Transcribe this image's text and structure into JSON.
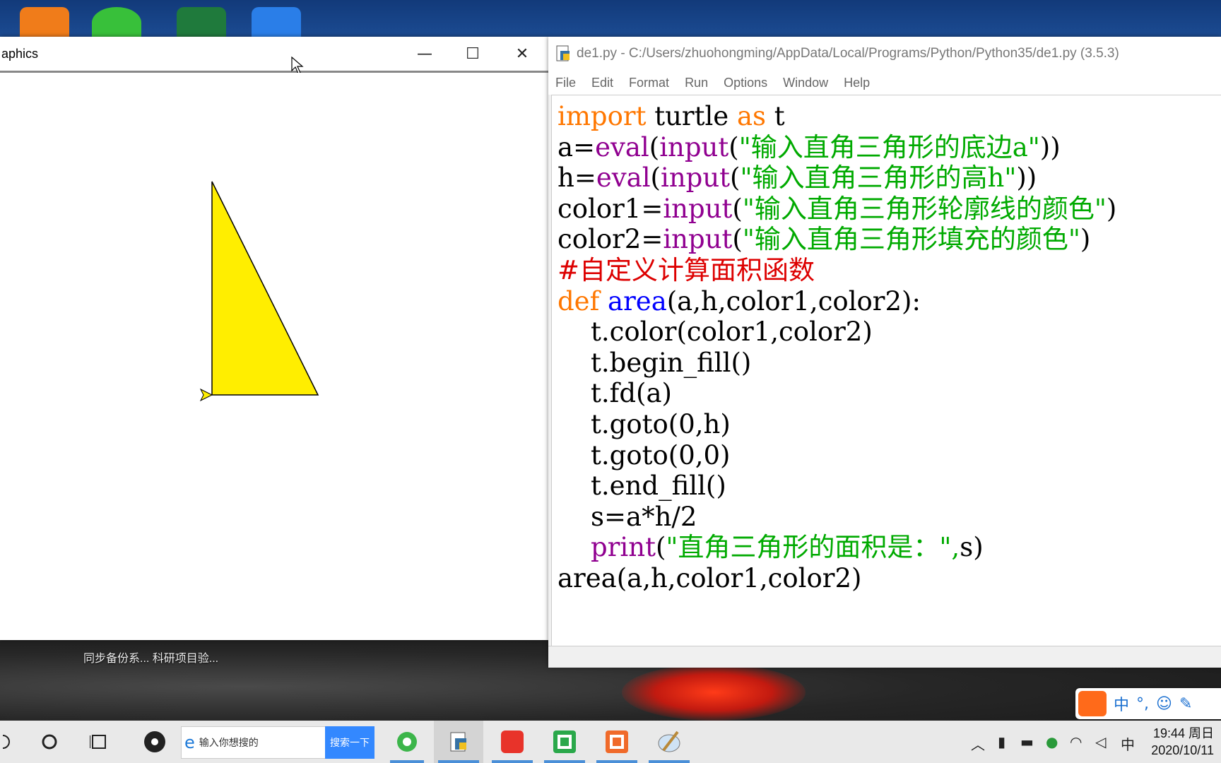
{
  "graphics_window": {
    "title": "aphics",
    "minimize": "—",
    "maximize": "☐",
    "close": "✕",
    "triangle_fill": "#ffee00",
    "triangle_outline": "#000000"
  },
  "idle": {
    "title": "de1.py - C:/Users/zhuohongming/AppData/Local/Programs/Python/Python35/de1.py (3.5.3)",
    "menu": [
      "File",
      "Edit",
      "Format",
      "Run",
      "Options",
      "Window",
      "Help"
    ]
  },
  "desktop": {
    "caption_line1": "同步备份系... 科研项目验..."
  },
  "ime": {
    "lang": "中",
    "punct": "°,",
    "emoji": "☺",
    "tool": "✎"
  },
  "taskbar": {
    "search_placeholder": "输入你想搜的",
    "search_button": "搜索一下",
    "clock_time": "19:44 周日",
    "clock_date": "2020/10/11",
    "ime_indicator": "中"
  },
  "colors": {
    "keyword": "#ff7700",
    "builtin": "#900090",
    "string": "#00aa00",
    "comment": "#dd0000",
    "definition": "#0000ff"
  }
}
